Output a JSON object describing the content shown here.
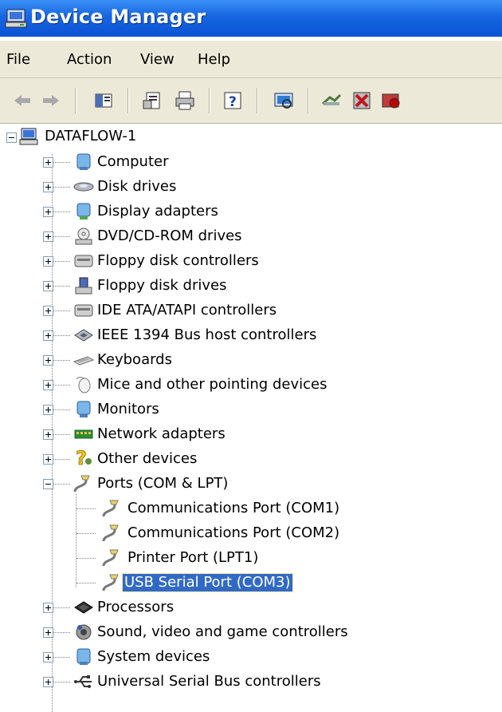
{
  "window": {
    "title": "Device Manager"
  },
  "menu": [
    "File",
    "Action",
    "View",
    "Help"
  ],
  "toolbar": [
    {
      "icon": "back-arrow-icon"
    },
    {
      "icon": "forward-arrow-icon"
    },
    {
      "icon": "show-hide-tree-icon"
    },
    {
      "icon": "properties-icon"
    },
    {
      "icon": "print-icon"
    },
    {
      "icon": "help-icon"
    },
    {
      "icon": "scan-hardware-icon"
    },
    {
      "icon": "update-driver-icon"
    },
    {
      "icon": "uninstall-icon"
    },
    {
      "icon": "disable-device-icon"
    }
  ],
  "tree": {
    "root": {
      "label": "DATAFLOW-1",
      "icon": "computer-icon"
    },
    "categories": [
      {
        "label": "Computer",
        "icon": "computer-icon"
      },
      {
        "label": "Disk drives",
        "icon": "disk-drive-icon"
      },
      {
        "label": "Display adapters",
        "icon": "display-adapter-icon"
      },
      {
        "label": "DVD/CD-ROM drives",
        "icon": "cdrom-icon"
      },
      {
        "label": "Floppy disk controllers",
        "icon": "controller-icon"
      },
      {
        "label": "Floppy disk drives",
        "icon": "floppy-drive-icon"
      },
      {
        "label": "IDE ATA/ATAPI controllers",
        "icon": "controller-icon"
      },
      {
        "label": "IEEE 1394 Bus host controllers",
        "icon": "ieee1394-icon"
      },
      {
        "label": "Keyboards",
        "icon": "keyboard-icon"
      },
      {
        "label": "Mice and other pointing devices",
        "icon": "mouse-icon"
      },
      {
        "label": "Monitors",
        "icon": "monitor-icon"
      },
      {
        "label": "Network adapters",
        "icon": "network-adapter-icon"
      },
      {
        "label": "Other devices",
        "icon": "unknown-device-icon"
      },
      {
        "label": "Ports (COM & LPT)",
        "icon": "port-icon",
        "expanded": true,
        "children": [
          {
            "label": "Communications Port (COM1)",
            "icon": "port-icon"
          },
          {
            "label": "Communications Port (COM2)",
            "icon": "port-icon"
          },
          {
            "label": "Printer Port (LPT1)",
            "icon": "port-icon"
          },
          {
            "label": "USB Serial Port (COM3)",
            "icon": "port-icon",
            "selected": true
          }
        ]
      },
      {
        "label": "Processors",
        "icon": "processor-icon"
      },
      {
        "label": "Sound, video and game controllers",
        "icon": "sound-icon"
      },
      {
        "label": "System devices",
        "icon": "system-device-icon"
      },
      {
        "label": "Universal Serial Bus controllers",
        "icon": "usb-icon"
      }
    ]
  },
  "colors": {
    "titlebar": "#0b52d6",
    "selection": "#316ac5",
    "chrome": "#ece9d8"
  }
}
